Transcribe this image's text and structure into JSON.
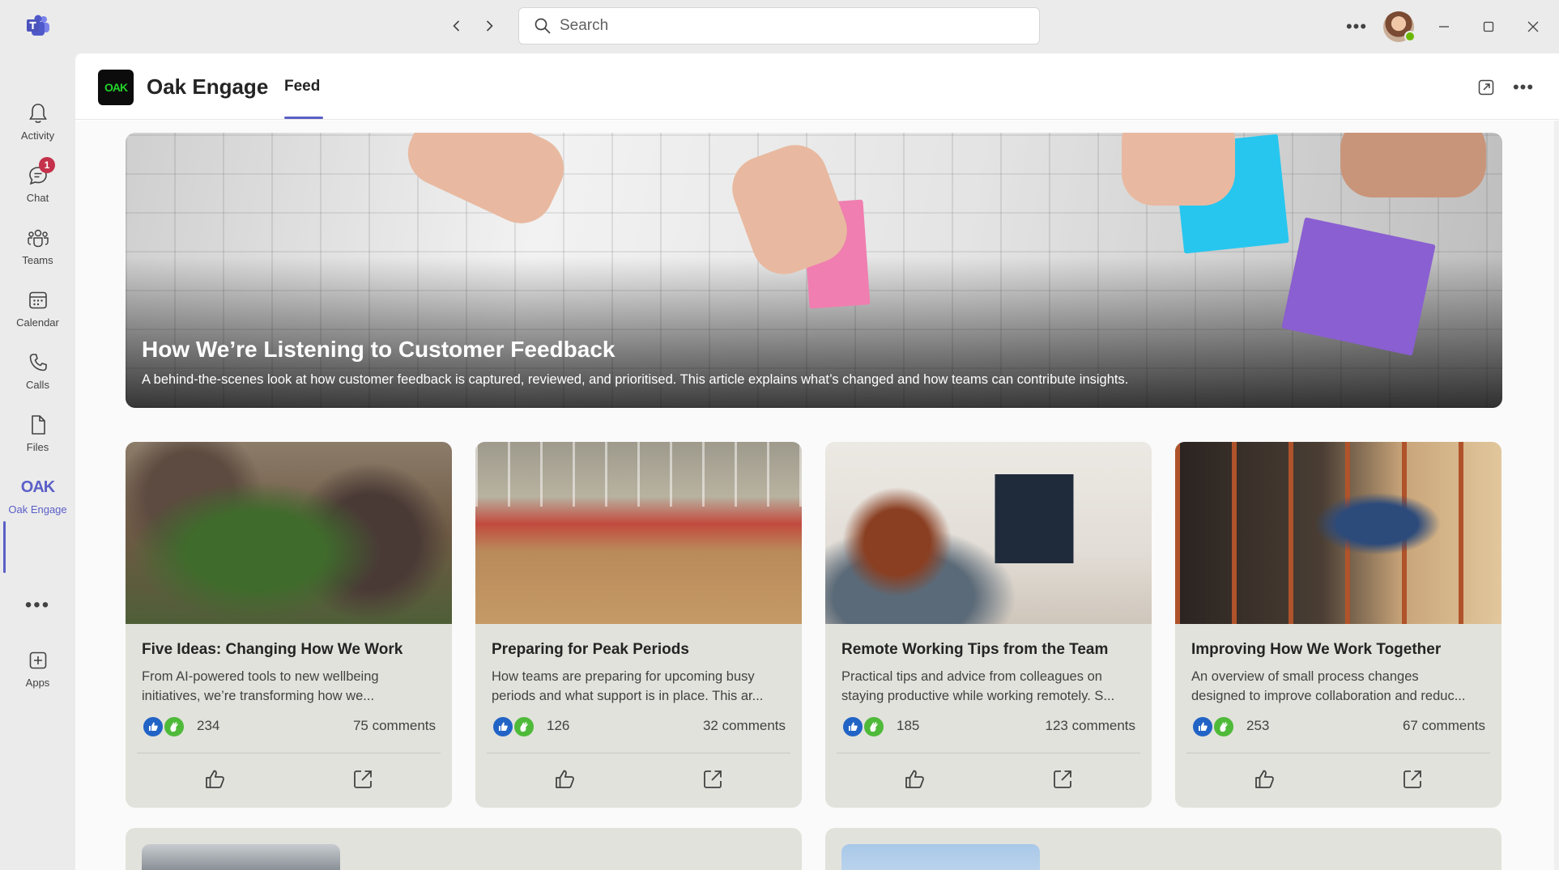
{
  "search": {
    "placeholder": "Search"
  },
  "rail": {
    "items": [
      {
        "label": "Activity"
      },
      {
        "label": "Chat",
        "badge": "1"
      },
      {
        "label": "Teams"
      },
      {
        "label": "Calendar"
      },
      {
        "label": "Calls"
      },
      {
        "label": "Files"
      },
      {
        "label": "Oak Engage",
        "logo": "OAK"
      },
      {
        "label": "Apps"
      }
    ]
  },
  "app": {
    "icon_text": "OAK",
    "title": "Oak Engage",
    "tabs": [
      {
        "label": "Feed",
        "selected": true
      }
    ]
  },
  "hero": {
    "title": "How We’re Listening to Customer Feedback",
    "description": "A behind-the-scenes look at how customer feedback is captured, reviewed, and prioritised. This article explains what’s changed and how teams can contribute insights."
  },
  "cards": [
    {
      "title": "Five Ideas: Changing How We Work",
      "desc_line1": "From AI-powered tools to new wellbeing",
      "desc_line2": "initiatives, we’re transforming how we...",
      "reactions": "234",
      "comments": "75 comments"
    },
    {
      "title": "Preparing for Peak Periods",
      "desc_line1": "How teams are preparing for upcoming busy",
      "desc_line2": "periods and what support is in place. This ar...",
      "reactions": "126",
      "comments": "32 comments"
    },
    {
      "title": "Remote Working Tips from the Team",
      "desc_line1": "Practical tips and advice from colleagues on",
      "desc_line2": "staying productive while working remotely. S...",
      "reactions": "185",
      "comments": "123 comments"
    },
    {
      "title": "Improving How We Work Together",
      "desc_line1": "An overview of small process changes",
      "desc_line2": "designed to improve collaboration and reduc...",
      "reactions": "253",
      "comments": "67 comments"
    }
  ],
  "colors": {
    "accent": "#5b5fc7",
    "badge": "#c4314b",
    "like": "#2264c6",
    "clap": "#4fba3a",
    "card_bg": "#e2e2dc",
    "oak_green": "#22d32a"
  },
  "icons": [
    "teams-logo-icon",
    "back-arrow-icon",
    "forward-arrow-icon",
    "search-icon",
    "more-icon",
    "minimize-icon",
    "maximize-icon",
    "close-icon",
    "bell-icon",
    "chat-icon",
    "teams-icon",
    "calendar-icon",
    "phone-icon",
    "file-icon",
    "apps-icon",
    "popout-icon",
    "thumbs-up-icon",
    "share-icon"
  ]
}
